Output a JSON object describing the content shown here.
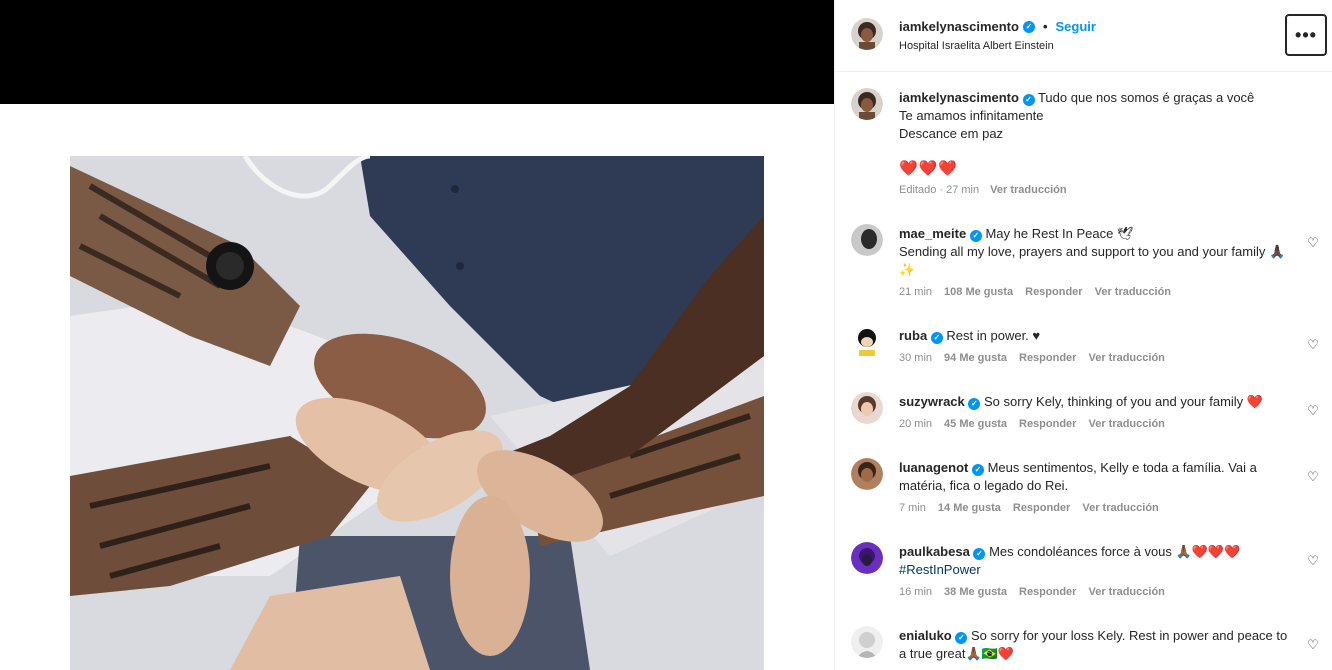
{
  "post": {
    "author": "iamkelynascimento",
    "follow_label": "Seguir",
    "location": "Hospital Israelita Albert Einstein",
    "more_label": "•••",
    "verified_mark": "✓"
  },
  "caption": {
    "username": "iamkelynascimento",
    "line1": "Tudo que nos somos é graças a você",
    "line2": "Te amamos infinitamente",
    "line3": "Descance em paz",
    "emojis": "❤️❤️❤️",
    "edited": "Editado · 27 min",
    "translate": "Ver traducción"
  },
  "comments": [
    {
      "username": "mae_meite",
      "text": "May he Rest In Peace 🕊",
      "text2": "Sending all my love, prayers and support to you and your family 🙏🏿✨",
      "time": "21 min",
      "likes": "108 Me gusta",
      "reply": "Responder",
      "translate": "Ver traducción"
    },
    {
      "username": "ruba",
      "text": "Rest in power. ♥",
      "time": "30 min",
      "likes": "94 Me gusta",
      "reply": "Responder",
      "translate": "Ver traducción"
    },
    {
      "username": "suzywrack",
      "text": "So sorry Kely, thinking of you and your family ❤️",
      "time": "20 min",
      "likes": "45 Me gusta",
      "reply": "Responder",
      "translate": "Ver traducción"
    },
    {
      "username": "luanagenot",
      "text": "Meus sentimentos, Kelly e toda a família. Vai a matéria, fica o legado do Rei.",
      "time": "7 min",
      "likes": "14 Me gusta",
      "reply": "Responder",
      "translate": "Ver traducción"
    },
    {
      "username": "paulkabesa",
      "text": "Mes condoléances force à vous 🙏🏾❤️❤️❤️",
      "hashtag": "#RestInPower",
      "time": "16 min",
      "likes": "38 Me gusta",
      "reply": "Responder",
      "translate": "Ver traducción"
    },
    {
      "username": "enialuko",
      "text": "So sorry for your loss Kely. Rest in power and peace to a true great🙏🏾🇧🇷❤️"
    }
  ],
  "icons": {
    "heart": "♡"
  }
}
